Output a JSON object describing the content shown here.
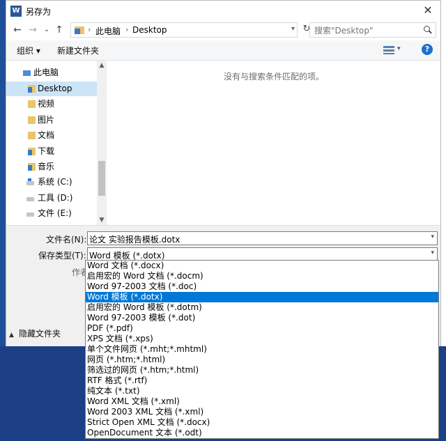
{
  "window": {
    "title": "另存为",
    "app_icon": "word-app-icon",
    "close_label": "✕"
  },
  "nav": {
    "back_icon": "←",
    "forward_icon": "→",
    "recent_icon": "⌄",
    "up_icon": "↑",
    "refresh_icon": "↻",
    "breadcrumb": [
      "此电脑",
      "Desktop"
    ],
    "breadcrumb_sep": "›",
    "search_placeholder": "搜索\"Desktop\""
  },
  "toolbar": {
    "organize": "组织 ▾",
    "new_folder": "新建文件夹",
    "help": "?"
  },
  "sidebar": {
    "items": [
      {
        "label": "此电脑",
        "icon": "computer-icon",
        "selected": false
      },
      {
        "label": "Desktop",
        "icon": "desktop-folder-icon",
        "selected": true
      },
      {
        "label": "视频",
        "icon": "videos-folder-icon",
        "selected": false
      },
      {
        "label": "图片",
        "icon": "pictures-folder-icon",
        "selected": false
      },
      {
        "label": "文档",
        "icon": "documents-folder-icon",
        "selected": false
      },
      {
        "label": "下载",
        "icon": "downloads-folder-icon",
        "selected": false
      },
      {
        "label": "音乐",
        "icon": "music-folder-icon",
        "selected": false
      },
      {
        "label": "系统 (C:)",
        "icon": "system-drive-icon",
        "selected": false
      },
      {
        "label": "工具 (D:)",
        "icon": "drive-icon",
        "selected": false
      },
      {
        "label": "文件 (E:)",
        "icon": "drive-icon",
        "selected": false
      }
    ]
  },
  "filelist": {
    "empty_message": "没有与搜索条件匹配的项。"
  },
  "form": {
    "filename_label": "文件名(N):",
    "filename_value": "论文 实验报告模板.dotx",
    "filetype_label": "保存类型(T):",
    "filetype_value": "Word 模板 (*.dotx)",
    "authors_label": "作者:",
    "hide_folders": "隐藏文件夹"
  },
  "filetype_options": [
    "Word 文档 (*.docx)",
    "启用宏的 Word 文档 (*.docm)",
    "Word 97-2003 文档 (*.doc)",
    "Word 模板 (*.dotx)",
    "启用宏的 Word 模板 (*.dotm)",
    "Word 97-2003 模板 (*.dot)",
    "PDF (*.pdf)",
    "XPS 文档 (*.xps)",
    "单个文件网页 (*.mht;*.mhtml)",
    "网页 (*.htm;*.html)",
    "筛选过的网页 (*.htm;*.html)",
    "RTF 格式 (*.rtf)",
    "纯文本 (*.txt)",
    "Word XML 文档 (*.xml)",
    "Word 2003 XML 文档 (*.xml)",
    "Strict Open XML 文档 (*.docx)",
    "OpenDocument 文本 (*.odt)"
  ],
  "selected_option_index": 3,
  "colors": {
    "accent": "#0078d7",
    "selected_tree": "#cce4f7",
    "desktop_bg": "#1f4f99"
  }
}
